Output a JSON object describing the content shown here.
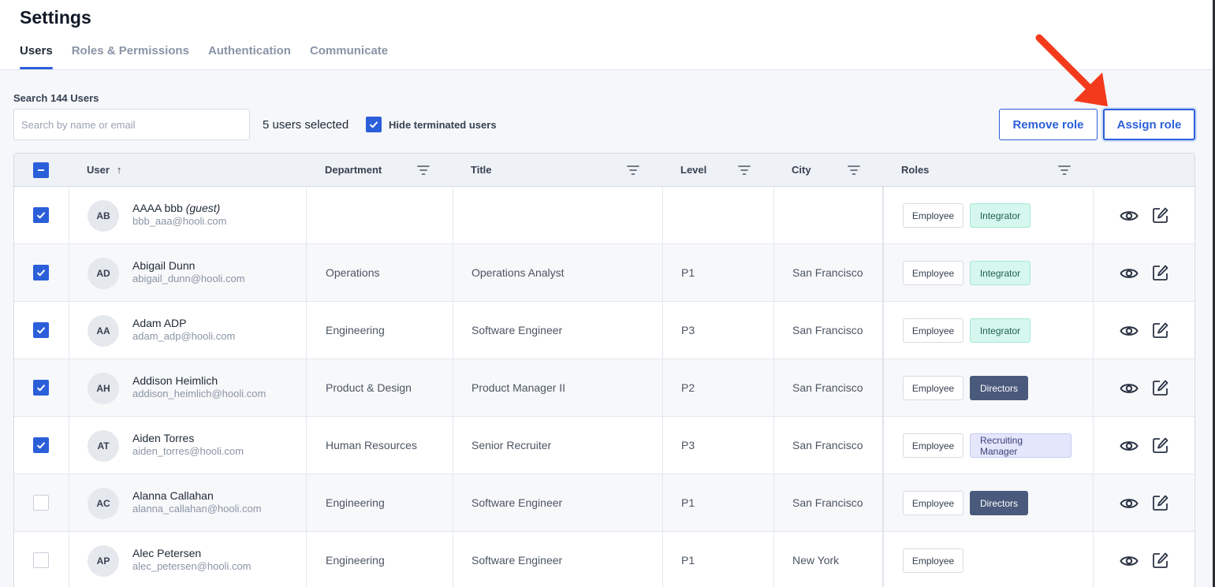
{
  "header": {
    "title": "Settings",
    "tabs": [
      {
        "label": "Users",
        "active": true
      },
      {
        "label": "Roles & Permissions",
        "active": false
      },
      {
        "label": "Authentication",
        "active": false
      },
      {
        "label": "Communicate",
        "active": false
      }
    ]
  },
  "toolbar": {
    "search_label": "Search 144 Users",
    "search_placeholder": "Search by name or email",
    "selected_count": "5 users selected",
    "hide_terminated_label": "Hide terminated users",
    "hide_terminated_checked": true,
    "remove_role_label": "Remove role",
    "assign_role_label": "Assign role"
  },
  "annotation": {
    "arrow_color": "#f43a1c",
    "points_to": "assign-role-button"
  },
  "table": {
    "columns": {
      "user": "User",
      "department": "Department",
      "title": "Title",
      "level": "Level",
      "city": "City",
      "roles": "Roles"
    },
    "sort_indicator": "↑",
    "rows": [
      {
        "initials": "AB",
        "name": "AAAA bbb",
        "name_suffix": "(guest)",
        "email": "bbb_aaa@hooli.com",
        "department": "",
        "title": "",
        "level": "",
        "city": "",
        "checked": true,
        "roles": [
          "Employee",
          "Integrator"
        ]
      },
      {
        "initials": "AD",
        "name": "Abigail Dunn",
        "name_suffix": "",
        "email": "abigail_dunn@hooli.com",
        "department": "Operations",
        "title": "Operations Analyst",
        "level": "P1",
        "city": "San Francisco",
        "checked": true,
        "roles": [
          "Employee",
          "Integrator"
        ]
      },
      {
        "initials": "AA",
        "name": "Adam ADP",
        "name_suffix": "",
        "email": "adam_adp@hooli.com",
        "department": "Engineering",
        "title": "Software Engineer",
        "level": "P3",
        "city": "San Francisco",
        "checked": true,
        "roles": [
          "Employee",
          "Integrator"
        ]
      },
      {
        "initials": "AH",
        "name": "Addison Heimlich",
        "name_suffix": "",
        "email": "addison_heimlich@hooli.com",
        "department": "Product & Design",
        "title": "Product Manager II",
        "level": "P2",
        "city": "San Francisco",
        "checked": true,
        "roles": [
          "Employee",
          "Directors"
        ]
      },
      {
        "initials": "AT",
        "name": "Aiden Torres",
        "name_suffix": "",
        "email": "aiden_torres@hooli.com",
        "department": "Human Resources",
        "title": "Senior Recruiter",
        "level": "P3",
        "city": "San Francisco",
        "checked": true,
        "roles": [
          "Employee",
          "Recruiting Manager"
        ]
      },
      {
        "initials": "AC",
        "name": "Alanna Callahan",
        "name_suffix": "",
        "email": "alanna_callahan@hooli.com",
        "department": "Engineering",
        "title": "Software Engineer",
        "level": "P1",
        "city": "San Francisco",
        "checked": false,
        "roles": [
          "Employee",
          "Directors"
        ]
      },
      {
        "initials": "AP",
        "name": "Alec Petersen",
        "name_suffix": "",
        "email": "alec_petersen@hooli.com",
        "department": "Engineering",
        "title": "Software Engineer",
        "level": "P1",
        "city": "New York",
        "checked": false,
        "roles": [
          "Employee"
        ]
      }
    ]
  },
  "colors": {
    "accent": "#2b5fd9",
    "integrator_bg": "#d5f7ee",
    "directors_bg": "#4a5a7c",
    "recruiting_bg": "#e4e6fb"
  }
}
